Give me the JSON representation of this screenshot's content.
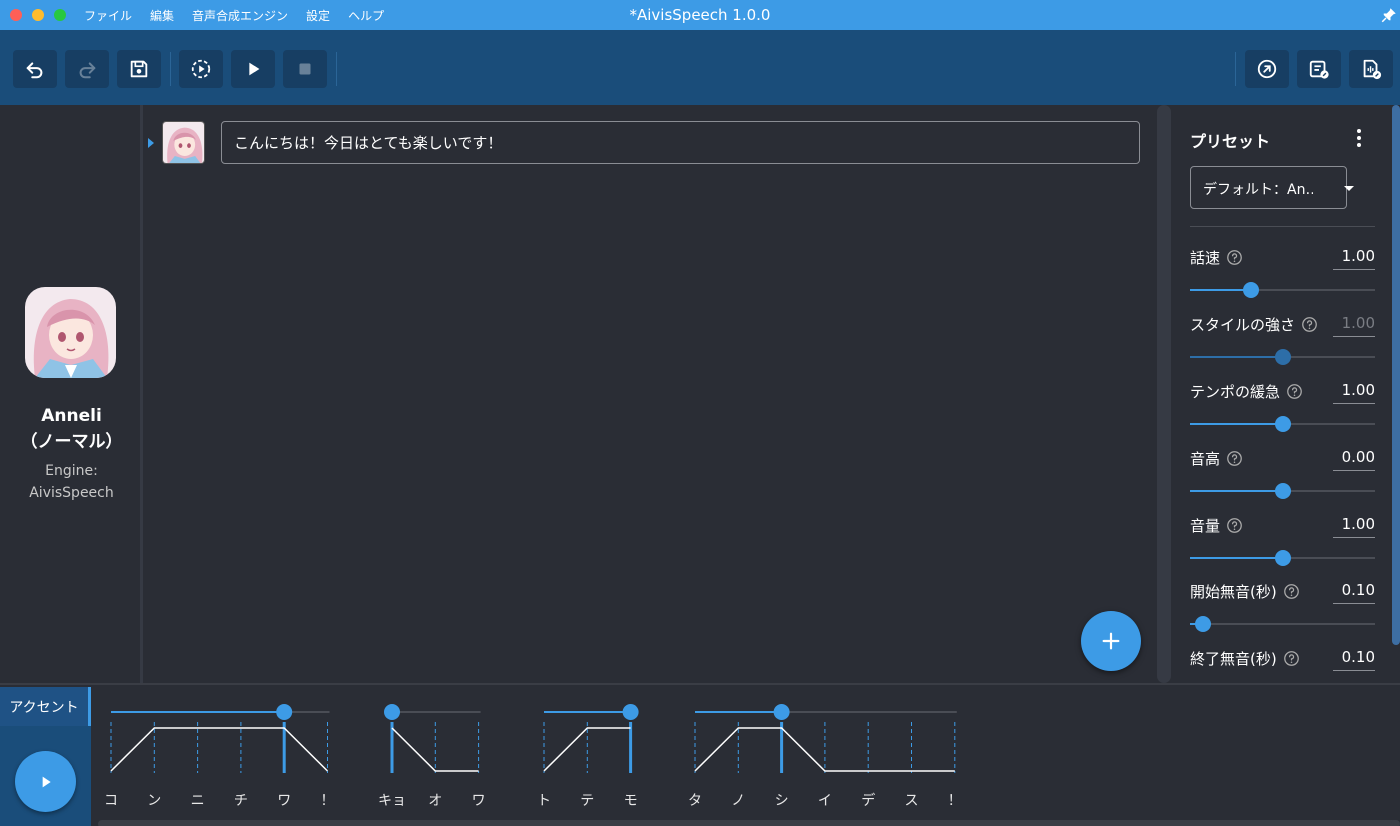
{
  "window": {
    "title": "*AivisSpeech 1.0.0",
    "menu": [
      "ファイル",
      "編集",
      "音声合成エンジン",
      "設定",
      "ヘルプ"
    ]
  },
  "toolbar": {
    "left_icons": [
      "undo-icon",
      "redo-icon",
      "save-icon",
      "continuous-play-icon",
      "play-icon",
      "stop-icon"
    ],
    "right_icons": [
      "open-external-icon",
      "export-text-icon",
      "export-audio-icon"
    ]
  },
  "character": {
    "name": "Anneli",
    "style": "（ノーマル）",
    "engine_label": "Engine:",
    "engine_name": "AivisSpeech"
  },
  "editor": {
    "rows": [
      {
        "text": "こんにちは！今日はとても楽しいです！"
      }
    ],
    "add_icon": "plus-icon"
  },
  "preset": {
    "title": "プリセット",
    "selected": "デフォルト：An…",
    "params": [
      {
        "label": "話速",
        "value": "1.00",
        "fraction": 0.33,
        "dim": false
      },
      {
        "label": "スタイルの強さ",
        "value": "1.00",
        "fraction": 0.5,
        "dim": true
      },
      {
        "label": "テンポの緩急",
        "value": "1.00",
        "fraction": 0.5,
        "dim": false
      },
      {
        "label": "音高",
        "value": "0.00",
        "fraction": 0.5,
        "dim": false
      },
      {
        "label": "音量",
        "value": "1.00",
        "fraction": 0.5,
        "dim": false
      },
      {
        "label": "開始無音(秒)",
        "value": "0.10",
        "fraction": 0.07,
        "dim": false
      },
      {
        "label": "終了無音(秒)",
        "value": "0.10",
        "fraction": 0.07,
        "dim": false
      }
    ]
  },
  "accent": {
    "tab_label": "アクセント",
    "groups": [
      {
        "morae": [
          "コ",
          "ン",
          "ニ",
          "チ",
          "ワ",
          "！"
        ],
        "accent": 5
      },
      {
        "morae": [
          "キョ",
          "オ",
          "ワ"
        ],
        "accent": 1
      },
      {
        "morae": [
          "ト",
          "テ",
          "モ"
        ],
        "accent": 3
      },
      {
        "morae": [
          "タ",
          "ノ",
          "シ",
          "イ",
          "デ",
          "ス",
          "！"
        ],
        "accent": 3
      }
    ]
  }
}
